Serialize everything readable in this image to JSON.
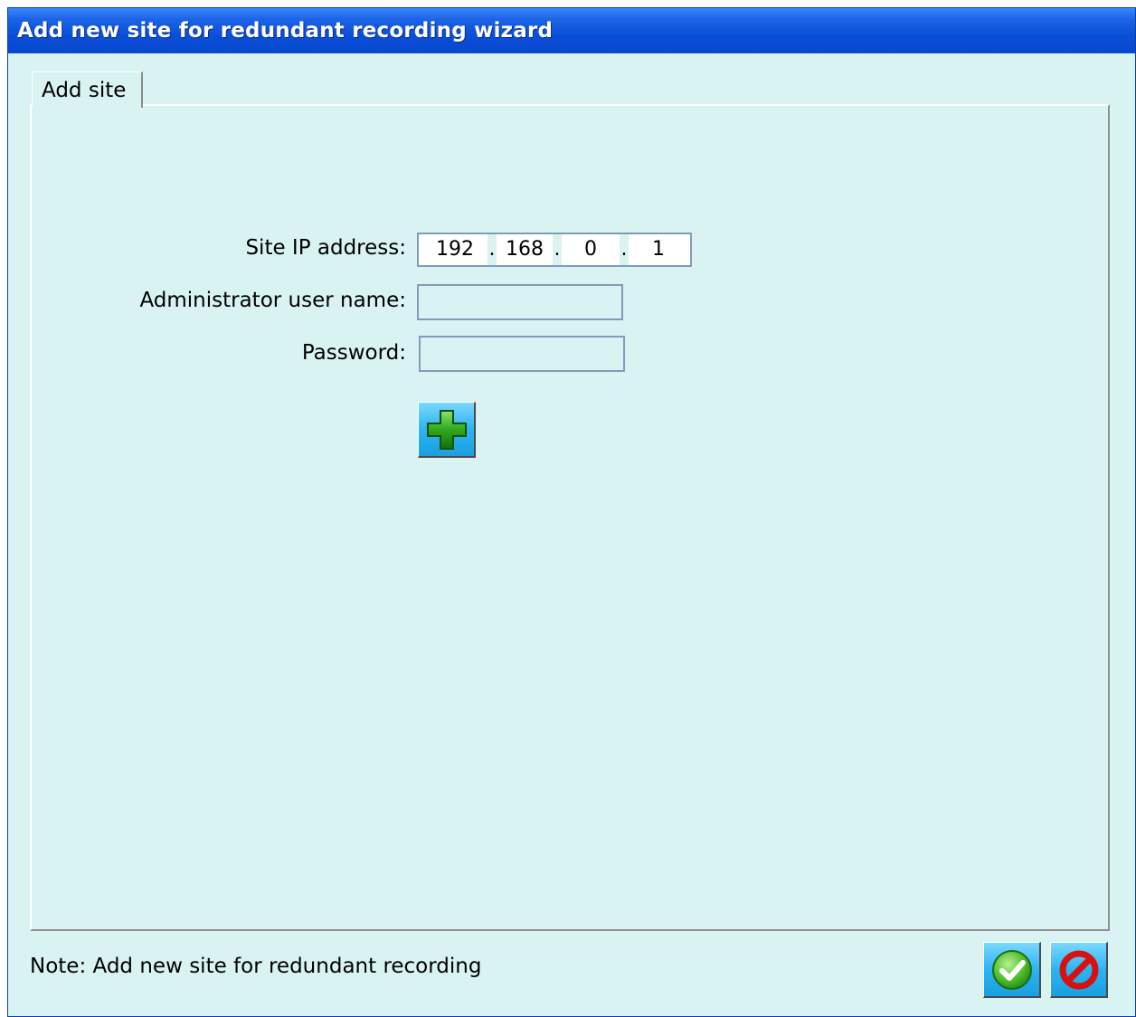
{
  "window": {
    "title": "Add new site for redundant recording wizard"
  },
  "tabs": [
    {
      "label": "Add site"
    }
  ],
  "form": {
    "ip_label": "Site IP address:",
    "ip_octets": [
      "192",
      "168",
      "0",
      "1"
    ],
    "ip_separators": [
      ".",
      ".",
      "."
    ],
    "username_label": "Administrator user name:",
    "username_value": "",
    "password_label": "Password:",
    "password_value": "",
    "add_icon": "green-plus-icon"
  },
  "footer": {
    "note": "Note: Add new site for redundant recording",
    "ok_icon": "green-check-icon",
    "cancel_icon": "red-prohibited-icon"
  },
  "colors": {
    "title_bar": "#0a4fd8",
    "background": "#d9f3f3",
    "button": "#2bb4f2"
  }
}
